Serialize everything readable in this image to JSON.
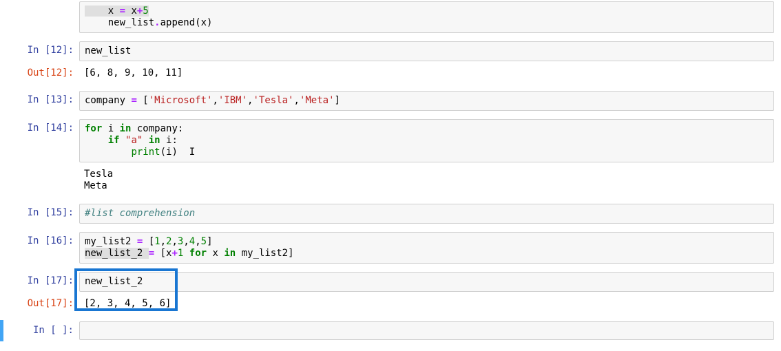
{
  "cell0": {
    "input": {
      "line1_a": "    x ",
      "line1_b": "=",
      "line1_c": " x",
      "line1_d": "+",
      "line1_e": "5",
      "line2_a": "    new_list",
      "line2_b": ".",
      "line2_c": "append(x)"
    }
  },
  "cell12": {
    "prompt_in": "In [12]:",
    "prompt_out": "Out[12]:",
    "input": "new_list",
    "output": "[6, 8, 9, 10, 11]"
  },
  "cell13": {
    "prompt_in": "In [13]:",
    "input": {
      "a": "company ",
      "b": "=",
      "c": " [",
      "s1": "'Microsoft'",
      "d": ",",
      "s2": "'IBM'",
      "e": ",",
      "s3": "'Tesla'",
      "f": ",",
      "s4": "'Meta'",
      "g": "]"
    }
  },
  "cell14": {
    "prompt_in": "In [14]:",
    "input": {
      "l1_a": "for",
      "l1_b": " i ",
      "l1_c": "in",
      "l1_d": " company:",
      "l2_a": "    ",
      "l2_b": "if",
      "l2_c": " ",
      "l2_d": "\"a\"",
      "l2_e": " ",
      "l2_f": "in",
      "l2_g": " i:",
      "l3_a": "        ",
      "l3_b": "print",
      "l3_c": "(i)"
    },
    "output": "Tesla\nMeta"
  },
  "cell15": {
    "prompt_in": "In [15]:",
    "input": "#list comprehension"
  },
  "cell16": {
    "prompt_in": "In [16]:",
    "input": {
      "l1_a": "my_list2 ",
      "l1_b": "=",
      "l1_c": " [",
      "l1_d": "1",
      "l1_e": ",",
      "l1_f": "2",
      "l1_g": ",",
      "l1_h": "3",
      "l1_i": ",",
      "l1_j": "4",
      "l1_k": ",",
      "l1_l": "5",
      "l1_m": "]",
      "l2_a": "new_list_2 ",
      "l2_b": "=",
      "l2_c": " [x",
      "l2_d": "+",
      "l2_e": "1",
      "l2_f": " ",
      "l2_g": "for",
      "l2_h": " x ",
      "l2_i": "in",
      "l2_j": " my_list2]"
    }
  },
  "cell17": {
    "prompt_in": "In [17]:",
    "prompt_out": "Out[17]:",
    "input": "new_list_2",
    "output": "[2, 3, 4, 5, 6]"
  },
  "cell_empty": {
    "prompt_in": "In [ ]:"
  }
}
